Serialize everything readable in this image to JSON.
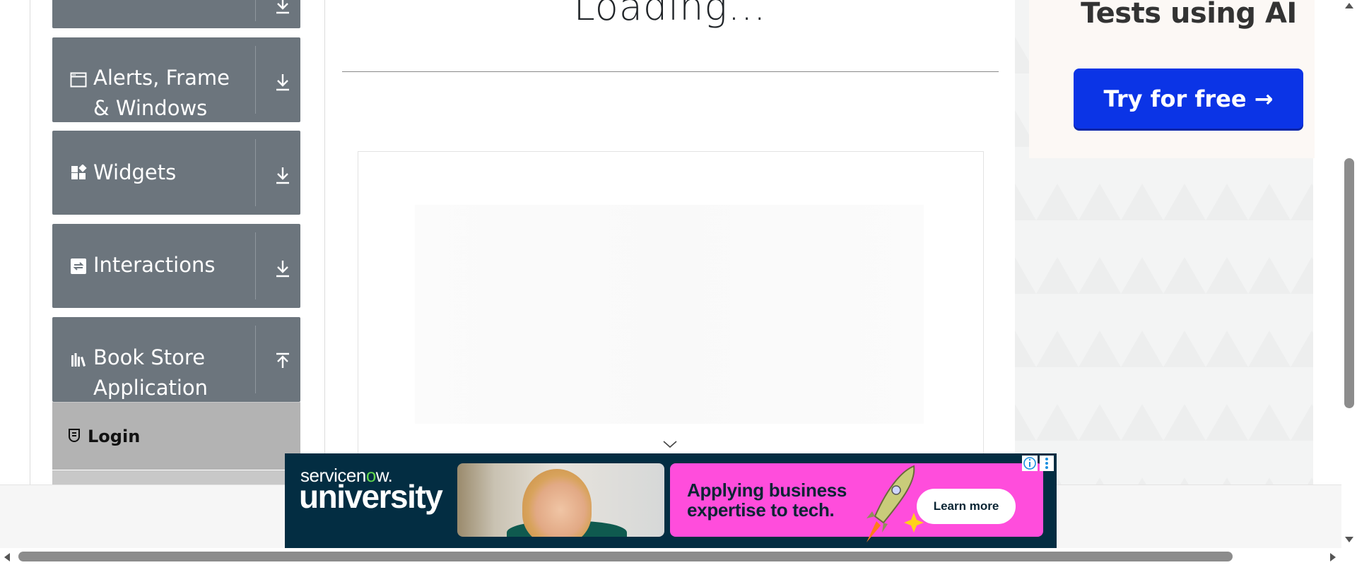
{
  "sidebar": {
    "groups": [
      {
        "label": "",
        "icon": "",
        "expanded": false
      },
      {
        "label": "Alerts, Frame & Windows",
        "icon": "window-icon",
        "expanded": false
      },
      {
        "label": "Widgets",
        "icon": "widgets-icon",
        "expanded": false
      },
      {
        "label": "Interactions",
        "icon": "interactions-icon",
        "expanded": false
      },
      {
        "label": "Book Store Application",
        "icon": "books-icon",
        "expanded": true
      }
    ],
    "active_item": {
      "label": "Login",
      "icon": "login-icon"
    }
  },
  "main": {
    "title": "Loading..."
  },
  "right_ad": {
    "heading": "Tests using AI",
    "cta_label": "Try for free →",
    "cta_color": "#0b34e6"
  },
  "banner_ad": {
    "brand_top_1": "servicen",
    "brand_top_o": "o",
    "brand_top_2": "w.",
    "brand_bottom": "university",
    "headline_line1": "Applying business",
    "headline_line2": "expertise to tech.",
    "cta_label": "Learn more",
    "accent_color": "#ff4ddc",
    "background_color": "#032d42"
  }
}
